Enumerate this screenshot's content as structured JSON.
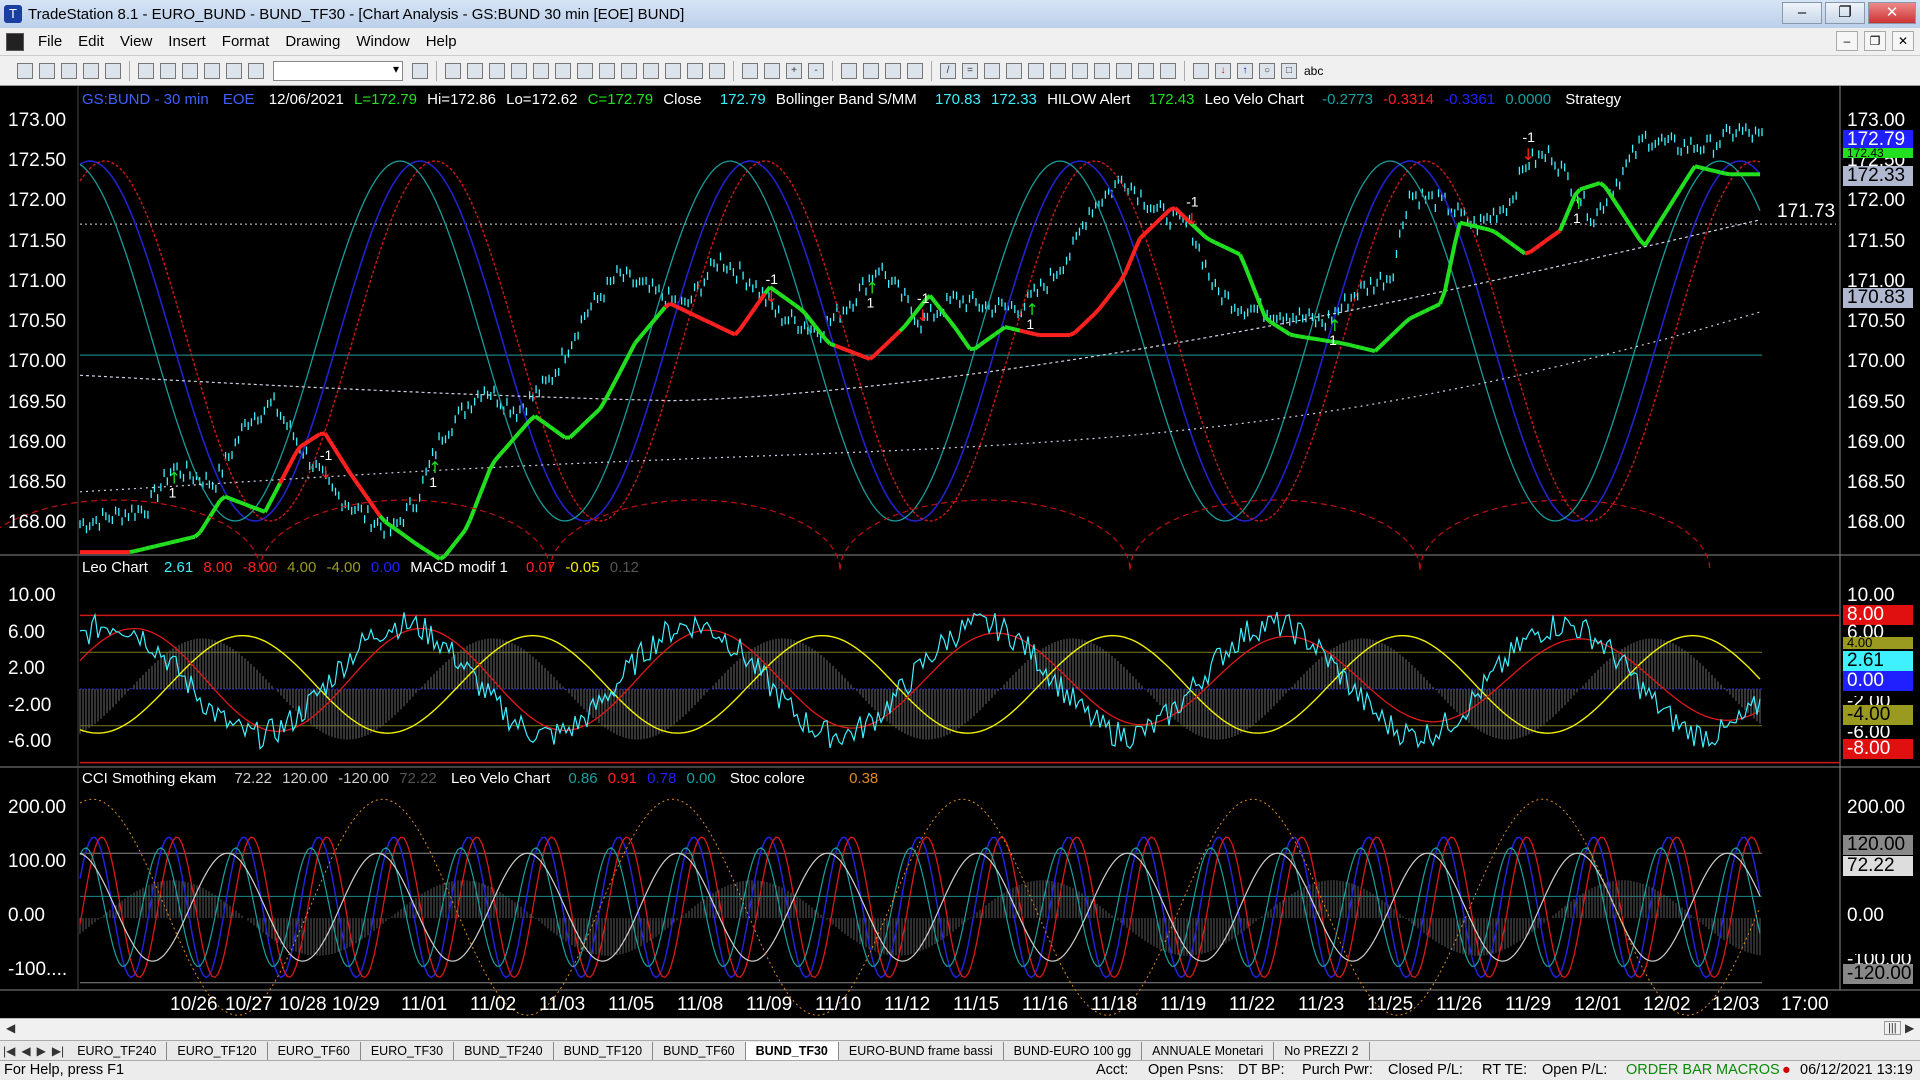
{
  "window": {
    "title": "TradeStation 8.1 - EURO_BUND - BUND_TF30 - [Chart Analysis - GS:BUND  30 min  [EOE] BUND]",
    "min": "–",
    "max": "❐",
    "close": "✕"
  },
  "menu": [
    "File",
    "Edit",
    "View",
    "Insert",
    "Format",
    "Drawing",
    "Window",
    "Help"
  ],
  "toolbar": {
    "buttons": [
      "new",
      "open",
      "save",
      "print",
      "cut",
      "copy",
      "paste",
      "undo",
      "chart",
      "quote",
      "zoom-in",
      "zoom-out",
      "pointer",
      "draw-line",
      "fib",
      "text",
      "arrow-up",
      "arrow-down"
    ],
    "text_tool": "abc"
  },
  "panel1": {
    "symbol": "GS:BUND - 30 min",
    "session": "EOE",
    "date": "12/06/2021",
    "last": "L=172.79",
    "high": "Hi=172.86",
    "low": "Lo=172.62",
    "close_field": "C=172.79",
    "close_label": "Close",
    "close_value": "172.79",
    "bb_label": "Bollinger Band S/MM",
    "bb_v1": "170.83",
    "bb_v2": "172.33",
    "hilow_label": "HILOW Alert",
    "hilow_value": "172.43",
    "leo_label": "Leo Velo Chart",
    "leo_v1": "-0.2773",
    "leo_v2": "-0.3314",
    "leo_v3": "-0.3361",
    "leo_v4": "0.0000",
    "strategy": "Strategy",
    "axis": [
      "173.00",
      "172.50",
      "172.00",
      "171.50",
      "171.00",
      "170.50",
      "170.00",
      "169.50",
      "169.00",
      "168.50",
      "168.00"
    ],
    "last_box": "172.79",
    "box_172_33": "172.33",
    "box_170_83": "170.83",
    "hline_value": "171.73",
    "hidden_box": "172.43",
    "axis_values": [
      173.0,
      172.5,
      172.0,
      171.5,
      171.0,
      170.5,
      170.0,
      169.5,
      169.0,
      168.5,
      168.0
    ],
    "signals": [
      {
        "text": "1",
        "dir": "up",
        "bar": 0.055
      },
      {
        "text": "-1",
        "dir": "down",
        "bar": 0.145
      },
      {
        "text": "1",
        "dir": "up",
        "bar": 0.21
      },
      {
        "text": "-1",
        "dir": "down",
        "bar": 0.41
      },
      {
        "text": "1",
        "dir": "up",
        "bar": 0.47
      },
      {
        "text": "-1",
        "dir": "down",
        "bar": 0.5
      },
      {
        "text": "1",
        "dir": "up",
        "bar": 0.565
      },
      {
        "text": "-1",
        "dir": "down",
        "bar": 0.66
      },
      {
        "text": "1",
        "dir": "up",
        "bar": 0.745
      },
      {
        "text": "-1",
        "dir": "down",
        "bar": 0.86
      },
      {
        "text": "1",
        "dir": "up",
        "bar": 0.89
      }
    ]
  },
  "panel2": {
    "leo_label": "Leo Chart",
    "v1": "2.61",
    "v2": "8.00",
    "v3": "-8.00",
    "v4": "4.00",
    "v5": "-4.00",
    "v6": "0.00",
    "macd_label": "MACD modif 1",
    "m1": "0.07",
    "m2": "-0.05",
    "m3": "0.12",
    "axis_left": [
      "10.00",
      "6.00",
      "2.00",
      "-2.00",
      "-6.00"
    ],
    "axis_right": [
      "10.00",
      "8.00",
      "6.00",
      "4.00",
      "2.61",
      "0.00",
      "-2.00",
      "-4.00",
      "-6.00",
      "-8.00"
    ],
    "axis_values": [
      10,
      6,
      2,
      -2,
      -6
    ]
  },
  "panel3": {
    "cci_label": "CCI Smothing ekam",
    "c1": "72.22",
    "c2": "120.00",
    "c3": "-120.00",
    "c4": "72.22",
    "leo_label": "Leo Velo Chart",
    "l1": "0.86",
    "l2": "0.91",
    "l3": "0.78",
    "l4": "0.00",
    "stoc_label": "Stoc colore",
    "s1": "0.38",
    "axis_left": [
      "200.00",
      "100.00",
      "0.00",
      "-100...."
    ],
    "axis_right": [
      "200.00",
      "120.00",
      "72.22",
      "0.00",
      "-100.00",
      "-120.00"
    ],
    "axis_values": [
      200,
      100,
      0,
      -100
    ]
  },
  "xaxis": [
    "10/26",
    "10/27",
    "10/28",
    "10/29",
    "11/01",
    "11/02",
    "11/03",
    "11/05",
    "11/08",
    "11/09",
    "11/10",
    "11/12",
    "11/15",
    "11/16",
    "11/18",
    "11/19",
    "11/22",
    "11/23",
    "11/25",
    "11/26",
    "11/29",
    "12/01",
    "12/02",
    "12/03",
    "17:00"
  ],
  "tabs": [
    "EURO_TF240",
    "EURO_TF120",
    "EURO_TF60",
    "EURO_TF30",
    "BUND_TF240",
    "BUND_TF120",
    "BUND_TF60",
    "BUND_TF30",
    "EURO-BUND frame bassi",
    "BUND-EURO 100 gg",
    "ANNUALE Monetari",
    "No PREZZI 2"
  ],
  "active_tab": "BUND_TF30",
  "status": {
    "help": "For Help, press F1",
    "acct": "Acct:",
    "open_psns": "Open Psns:",
    "dt_bp": "DT BP:",
    "purch_pwr": "Purch Pwr:",
    "closed_pl": "Closed P/L:",
    "rt_te": "RT TE:",
    "open_pl": "Open P/L:",
    "order_bar": "ORDER BAR",
    "macros": "MACROS",
    "datetime": "06/12/2021 13:19"
  },
  "colors": {
    "cyan": "#3ff0ff",
    "red": "#ff2020",
    "green": "#22e020",
    "blue": "#1818ff",
    "yellow": "#f0f000",
    "teal": "#10a0a0",
    "darkred": "#c01010"
  }
}
